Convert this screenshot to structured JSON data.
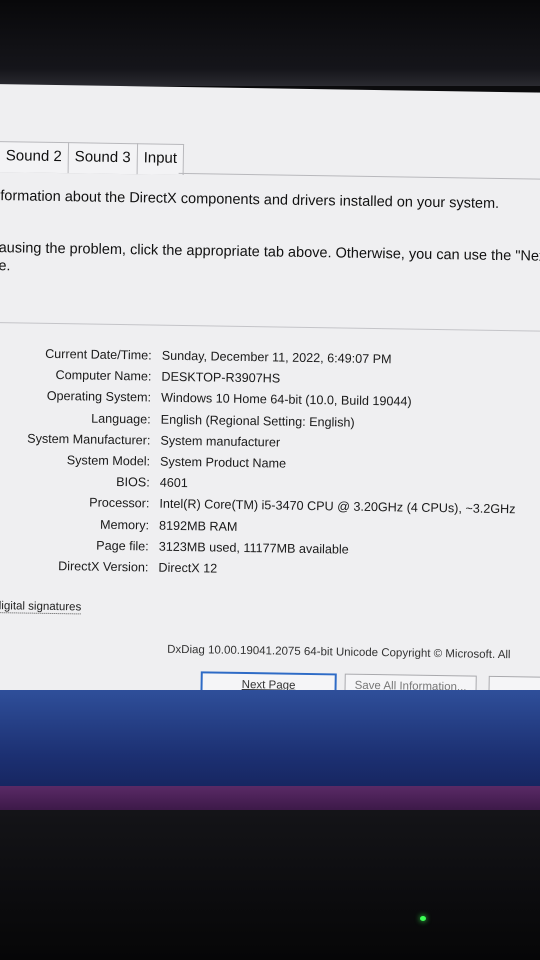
{
  "tabs": [
    "Sound 2",
    "Sound 3",
    "Input"
  ],
  "intro": {
    "line1": "nformation about the DirectX components and drivers installed on your system.",
    "line2": "causing the problem, click the appropriate tab above.  Otherwise, you can use the \"Next P",
    "line3": "ce."
  },
  "system_info": [
    {
      "label": "Current Date/Time:",
      "value": "Sunday, December 11, 2022, 6:49:07 PM"
    },
    {
      "label": "Computer Name:",
      "value": "DESKTOP-R3907HS"
    },
    {
      "label": "Operating System:",
      "value": "Windows 10 Home 64-bit (10.0, Build 19044)"
    },
    {
      "label": "Language:",
      "value": "English (Regional Setting: English)"
    },
    {
      "label": "System Manufacturer:",
      "value": "System manufacturer"
    },
    {
      "label": "System Model:",
      "value": "System Product Name"
    },
    {
      "label": "BIOS:",
      "value": "4601"
    },
    {
      "label": "Processor:",
      "value": "Intel(R) Core(TM) i5-3470 CPU @ 3.20GHz (4 CPUs), ~3.2GHz"
    },
    {
      "label": "Memory:",
      "value": "8192MB RAM"
    },
    {
      "label": "Page file:",
      "value": "3123MB used, 11177MB available"
    },
    {
      "label": "DirectX Version:",
      "value": "DirectX 12"
    }
  ],
  "signatures_label": "L digital signatures",
  "footer_text": "DxDiag 10.00.19041.2075 64-bit Unicode  Copyright © Microsoft. All",
  "buttons": {
    "next_page": "Next Page",
    "save_all": "Save All Information..."
  }
}
